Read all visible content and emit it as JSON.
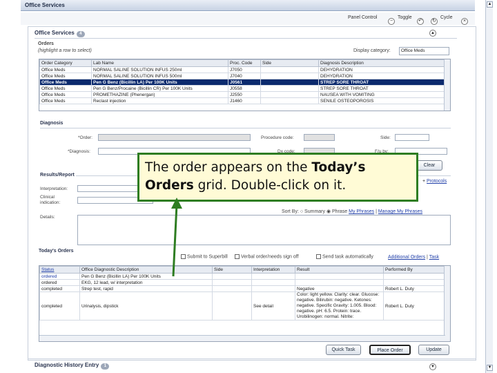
{
  "window": {
    "title": "Office Services",
    "minimize": "-",
    "maximize": "□",
    "close": "×"
  },
  "panel_control": {
    "label": "Panel Control",
    "toggle": "Toggle",
    "cycle": "Cycle"
  },
  "office_services": {
    "title": "Office Services",
    "badge": "4",
    "orders_label": "Orders",
    "orders_hint": "(highlight a row to select)",
    "display_category_label": "Display category:",
    "display_category_value": "Office Meds",
    "columns": [
      "Order Category",
      "Lab Name",
      "Proc. Code",
      "Side",
      "Diagnosis Description"
    ],
    "rows": [
      [
        "Office Meds",
        "NORMAL SALINE SOLUTION INFUS 250ml",
        "J7050",
        "",
        "DEHYDRATION"
      ],
      [
        "Office Meds",
        "NORMAL SALINE SOLUTION INFUS 500ml",
        "J7040",
        "",
        "DEHYDRATION"
      ],
      [
        "Office Meds",
        "Pen G Benz (Bicillin LA) Per 100K Units",
        "J0561",
        "",
        "STREP SORE THROAT"
      ],
      [
        "Office Meds",
        "Pen G Benz/Procaine (Bicillin CR) Per 100K Units",
        "J0558",
        "",
        "STREP SORE THROAT"
      ],
      [
        "Office Meds",
        "PROMETHAZINE (Phenergan)",
        "J2550",
        "",
        "NAUSEA WITH VOMITING"
      ],
      [
        "Office Meds",
        "Reclast injection",
        "J1460",
        "",
        "SENILE OSTEOPOROSIS"
      ]
    ],
    "selected_row": 2
  },
  "diagnosis": {
    "title": "Diagnosis",
    "order_label": "*Order:",
    "diagnosis_label": "*Diagnosis:",
    "procedure_code_label": "Procedure code:",
    "dx_code_label": "Dx code:",
    "side_label": "Side:",
    "fu_label": "F/u by:",
    "clear_label": "Clear"
  },
  "results": {
    "title": "Results/Report",
    "interpretation_label": "Interpretation:",
    "clinical_indication_label": "Clinical indication:",
    "details_label": "Details:",
    "protocols_label": "Protocols",
    "sort_by_label": "Sort By:",
    "sort_summary": "Summary",
    "sort_phrase": "Phrase",
    "my_phrases": "My Phrases",
    "manage_my_phrases": "Manage My Phrases"
  },
  "todays_orders": {
    "title": "Today's Orders",
    "submit_superbill": "Submit to Superbill",
    "verbal_order": "Verbal order/needs sign off",
    "send_task": "Send task automatically",
    "additional_orders": "Additional Orders",
    "task_link": "Task",
    "columns": [
      "Status",
      "Office Diagnostic Description",
      "Side",
      "Interpretation",
      "Result",
      "Performed By"
    ],
    "rows": [
      [
        "ordered",
        "Pen G Benz (Bicillin LA) Per 100K Units",
        "",
        "",
        "",
        ""
      ],
      [
        "ordered",
        "EKG, 12 lead, w/ interpretation",
        "",
        "",
        "",
        ""
      ],
      [
        "completed",
        "Strep test, rapid",
        "",
        "",
        "Negative",
        "Robert L. Duty"
      ],
      [
        "completed",
        "Urinalysis, dipstick",
        "",
        "See detail",
        "Color: light yellow. Clarity: clear. Glucose: negative. Bilirubin: negative. Ketones: negative. Specific Gravity: 1.005. Blood: negative. pH: 6.5. Protein: trace. Urobilinogen: normal. Nitrite:",
        "Robert L. Duty"
      ]
    ]
  },
  "buttons": {
    "quick_task": "Quick Task",
    "place_order": "Place Order",
    "update": "Update"
  },
  "history": {
    "title": "Diagnostic History Entry",
    "badge": "1"
  },
  "callout": {
    "line1_plain": "The order appears on the ",
    "line1_bold": "Today’s",
    "line2_bold": "Orders",
    "line2_plain": " grid. Double-click on it."
  },
  "colors": {
    "callout_border": "#2e7d22",
    "selected_row": "#0b2a6e",
    "link": "#1f3ea8"
  }
}
